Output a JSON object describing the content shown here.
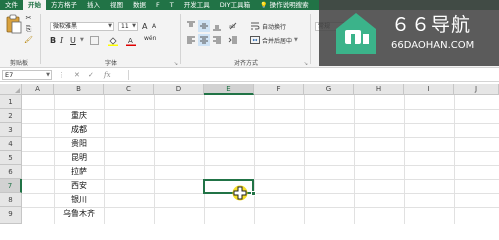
{
  "menu": {
    "tabs": [
      {
        "label": "文件",
        "active": false
      },
      {
        "label": "开始",
        "active": true
      },
      {
        "label": "方方格子",
        "active": false
      },
      {
        "label": "插入",
        "active": false
      },
      {
        "label": "视图",
        "active": false
      },
      {
        "label": "数据",
        "active": false
      },
      {
        "label": "F",
        "active": false
      },
      {
        "label": "T",
        "active": false
      },
      {
        "label": "开发工具",
        "active": false
      },
      {
        "label": "DIY工具箱",
        "active": false
      }
    ],
    "tell_me": "操作说明搜索"
  },
  "ribbon": {
    "clipboard": {
      "label": "剪贴板"
    },
    "font": {
      "label": "字体",
      "name": "微软雅黑",
      "size": "11",
      "grow": "A",
      "shrink": "A",
      "bold": "B",
      "italic": "I",
      "underline": "U",
      "wen": "wén"
    },
    "alignment": {
      "label": "对齐方式",
      "wrap_text": "自动换行",
      "merge_center": "合并后居中"
    },
    "number": {
      "format": "常规"
    }
  },
  "formula_bar": {
    "name_box": "E7",
    "cancel": "✕",
    "enter": "✓",
    "fx": "fx",
    "value": ""
  },
  "grid": {
    "columns": [
      "A",
      "B",
      "C",
      "D",
      "E",
      "F",
      "G",
      "H",
      "I",
      "J"
    ],
    "rows": [
      "1",
      "2",
      "3",
      "4",
      "5",
      "6",
      "7",
      "8",
      "9"
    ],
    "selected_column": "E",
    "selected_row": "7",
    "column_b_values": [
      "重庆",
      "成都",
      "贵阳",
      "昆明",
      "拉萨",
      "西安",
      "银川",
      "乌鲁木齐"
    ]
  },
  "watermark": {
    "title": "６６导航",
    "domain": "66DAOHAN.COM"
  },
  "colors": {
    "excel_green": "#217346",
    "selection_border": "#217346",
    "cursor_yellow": "#f5d800"
  },
  "icons": {
    "paste": "paste-icon",
    "cut": "scissors-icon",
    "copy": "copy-icon",
    "format_painter": "paintbrush-icon",
    "bold": "bold-icon",
    "fill_color": "fill-bucket-icon",
    "font_color": "font-color-icon",
    "wrap_text": "wrap-text-icon",
    "merge": "merge-cells-icon",
    "cursor": "cell-select-cursor-icon",
    "logo": "house-logo-icon"
  }
}
